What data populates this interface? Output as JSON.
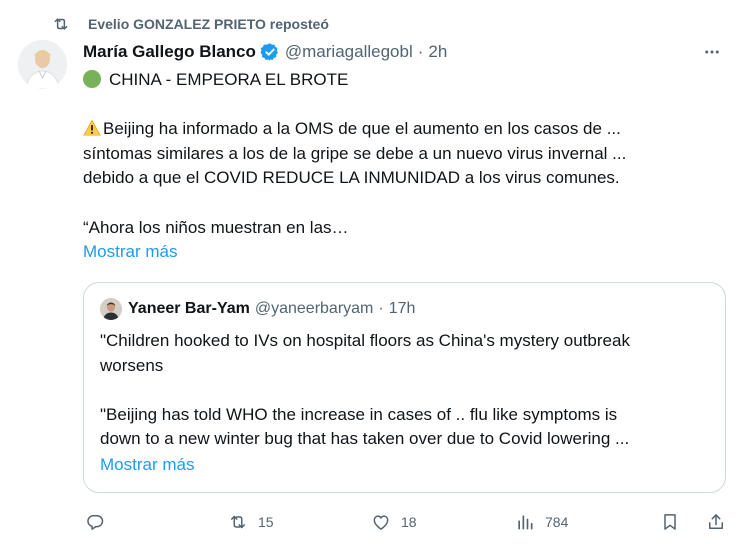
{
  "repost": {
    "text": "Evelio GONZALEZ PRIETO reposteó",
    "icon": "repost-icon"
  },
  "tweet": {
    "author_name": "María Gallego Blanco",
    "verified": true,
    "handle": "@mariagallegobl",
    "separator": "·",
    "time": "2h",
    "lines": {
      "l1": "CHINA - EMPEORA EL BROTE",
      "l2": "Beijing ha informado a la OMS de que el aumento en los casos de ...",
      "l3": "síntomas similares a los de la gripe se debe a un nuevo virus invernal ...",
      "l4": "debido a que el COVID REDUCE LA INMUNIDAD a los virus comunes.",
      "l5": "“Ahora los niños muestran en las…"
    },
    "show_more": "Mostrar más"
  },
  "quote": {
    "author_name": "Yaneer Bar-Yam",
    "handle": "@yaneerbaryam",
    "separator": "·",
    "time": "17h",
    "lines": {
      "l1": "\"Children hooked to IVs on hospital floors as China's mystery outbreak",
      "l2": "worsens",
      "l3": "\"Beijing has told WHO the increase in cases of .. flu like symptoms is",
      "l4": "down to a new winter bug that has taken over due to Covid lowering ..."
    },
    "show_more": "Mostrar más"
  },
  "actions": {
    "reply_count": "",
    "repost_count": "15",
    "like_count": "18",
    "views_count": "784"
  },
  "colors": {
    "text": "#0f1419",
    "muted": "#536471",
    "link": "#1d9bf0",
    "verified": "#1d9bf0",
    "border": "#cfd9de",
    "green_circle": "#78b159"
  }
}
